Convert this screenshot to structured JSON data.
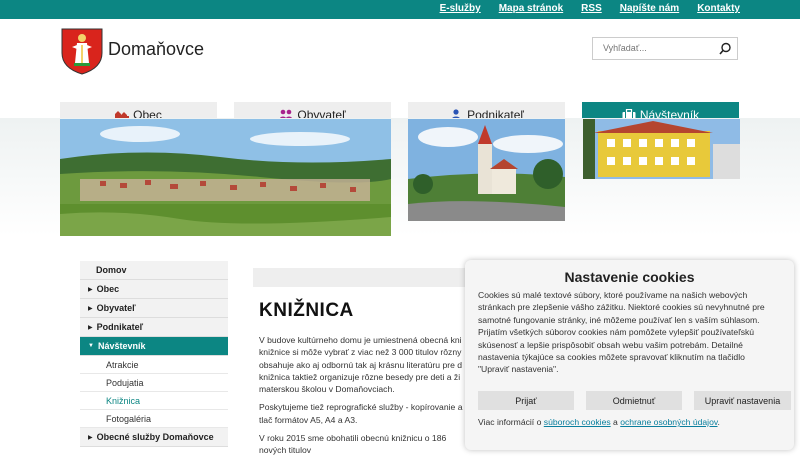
{
  "top_links": [
    "E-služby",
    "Mapa stránok",
    "RSS",
    "Napíšte nám",
    "Kontakty"
  ],
  "site_title": "Domaňovce",
  "search": {
    "placeholder": "Vyhľadať..."
  },
  "nav": [
    {
      "label": "Obec",
      "icon": "town-icon"
    },
    {
      "label": "Obyvateľ",
      "icon": "people-icon"
    },
    {
      "label": "Podnikateľ",
      "icon": "person-icon"
    },
    {
      "label": "Návštevník",
      "icon": "suitcase-icon",
      "active": true
    }
  ],
  "sidebar": {
    "home": "Domov",
    "items": [
      "Obec",
      "Obyvateľ",
      "Podnikateľ"
    ],
    "active": "Návštevník",
    "sub": [
      "Atrakcie",
      "Podujatia",
      "Knižnica",
      "Fotogaléria"
    ],
    "current_sub": "Knižnica",
    "after": "Obecné služby Domaňovce"
  },
  "content": {
    "title": "KNIŽNICA",
    "lines": [
      "V budove kultúrneho domu je umiestnená obecná kni",
      "knižnice si môže vybrať z viac než 3 000 titulov rôzny",
      "obsahuje ako aj odbornú tak aj krásnu literatúru pre d",
      "knižnica taktiež organizuje rôzne besedy pre deti a ži",
      "materskou školou v Domaňovciach."
    ],
    "lines2": [
      "Poskytujeme tiež reprografické služby - kopírovanie a",
      "tlač formátov A5, A4 a A3."
    ],
    "lines3": [
      "V roku 2015 sme obohatili obecnú knižnicu o 186",
      "nových titulov"
    ]
  },
  "cookie": {
    "title": "Nastavenie cookies",
    "text": [
      "Cookies sú malé textové súbory, ktoré používame na našich webových",
      "stránkach pre zlepšenie vášho zážitku. Niektoré cookies sú nevyhnutné pre",
      "samotné fungovanie stránky, iné môžeme používať len s vaším súhlasom.",
      "Prijatím všetkých súborov cookies nám pomôžete vylepšiť používateľskú",
      "skúsenosť a lepšie prispôsobiť obsah webu vašim potrebám. Detailné",
      "nastavenia týkajúce sa cookies môžete spravovať kliknutím na tlačidlo",
      "\"Upraviť nastavenia\"."
    ],
    "accept": "Prijať",
    "reject": "Odmietnuť",
    "settings": "Upraviť nastavenia",
    "info_prefix": "Viac informácií o ",
    "info_link1": "súboroch cookies",
    "info_mid": " a ",
    "info_link2": "ochrane osobných údajov",
    "info_suffix": "."
  },
  "colors": {
    "accent": "#0c8683",
    "nav_bg": "#eeeeee",
    "link": "#0a7f9e"
  }
}
